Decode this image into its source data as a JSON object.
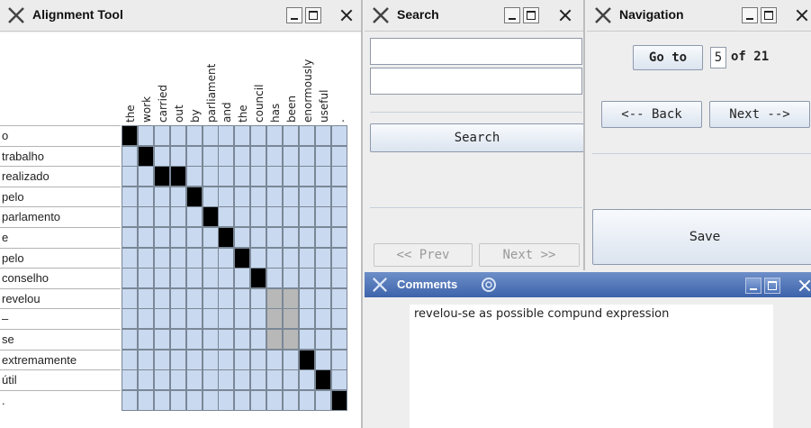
{
  "alignment": {
    "title": "Alignment Tool",
    "columns": [
      "the",
      "work",
      "carried",
      "out",
      "by",
      "parliament",
      "and",
      "the",
      "council",
      "has",
      "been",
      "enormously",
      "useful",
      "."
    ],
    "rows": [
      "o",
      "trabalho",
      "realizado",
      "pelo",
      "parlamento",
      "e",
      "pelo",
      "conselho",
      "revelou",
      "–",
      "se",
      "extremamente",
      "útil",
      "."
    ],
    "links": [
      [
        0,
        0
      ],
      [
        1,
        1
      ],
      [
        2,
        2
      ],
      [
        2,
        3
      ],
      [
        3,
        4
      ],
      [
        4,
        5
      ],
      [
        5,
        6
      ],
      [
        6,
        7
      ],
      [
        7,
        8
      ],
      [
        11,
        11
      ],
      [
        12,
        12
      ],
      [
        13,
        13
      ]
    ],
    "possible": [
      [
        8,
        9
      ],
      [
        8,
        10
      ],
      [
        9,
        9
      ],
      [
        9,
        10
      ],
      [
        10,
        9
      ],
      [
        10,
        10
      ]
    ]
  },
  "search": {
    "title": "Search",
    "field1_value": "",
    "field2_value": "",
    "search_label": "Search",
    "prev_label": "<< Prev",
    "next_label": "Next >>"
  },
  "navigation": {
    "title": "Navigation",
    "goto_label": "Go to",
    "current_page": "5",
    "of_label": "of 21",
    "back_label": "<-- Back",
    "next_label": "Next -->",
    "save_label": "Save"
  },
  "comments": {
    "title": "Comments",
    "text": "revelou-se as possible compund expression"
  }
}
